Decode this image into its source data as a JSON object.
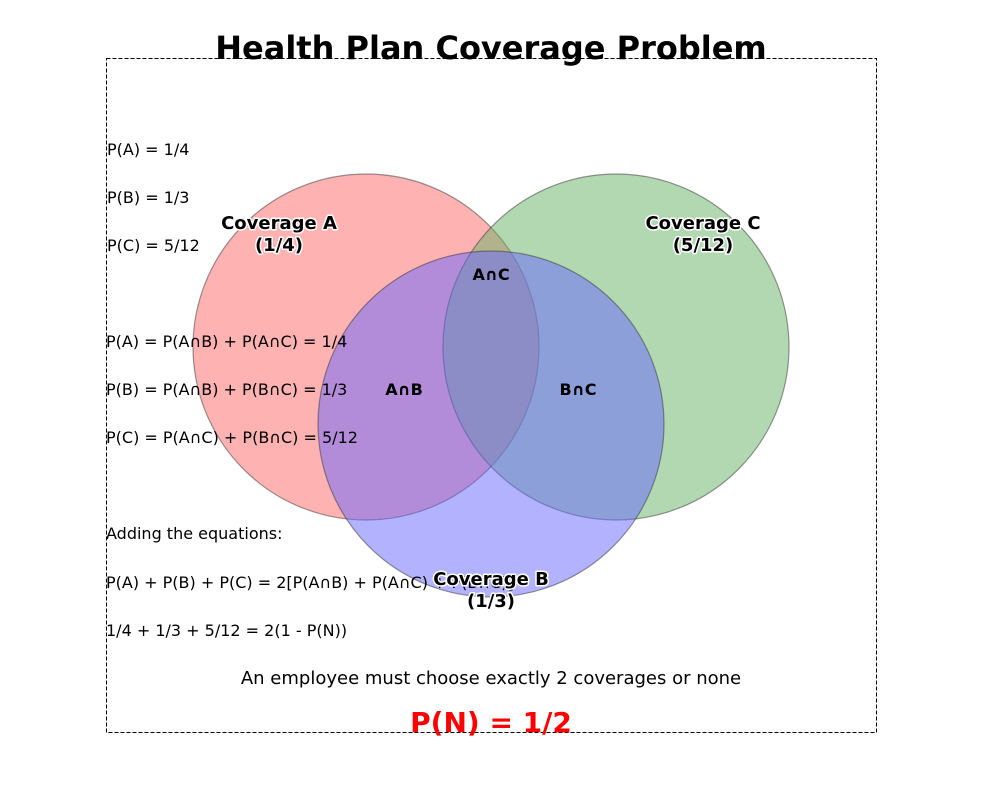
{
  "title": "Health Plan Coverage Problem",
  "circles": {
    "a": {
      "label": "Coverage A",
      "value": "(1/4)",
      "color": "#ff6666"
    },
    "b": {
      "label": "Coverage B",
      "value": "(1/3)",
      "color": "#6666ff"
    },
    "c": {
      "label": "Coverage C",
      "value": "(5/12)",
      "color": "#66b266"
    }
  },
  "regions": {
    "ab": "A∩B",
    "ac": "A∩C",
    "bc": "B∩C"
  },
  "probabilities": {
    "pa": "P(A) = 1/4",
    "pb": "P(B) = 1/3",
    "pc": "P(C) = 5/12"
  },
  "equations": {
    "eq1": "P(A) = P(A∩B) + P(A∩C) = 1/4",
    "eq2": "P(B) = P(A∩B) + P(B∩C) = 1/3",
    "eq3": "P(C) = P(A∩C) + P(B∩C) = 5/12"
  },
  "adding": {
    "heading": "Adding the equations:",
    "line1": "P(A) + P(B) + P(C) = 2[P(A∩B) + P(A∩C) + P(B∩C)]",
    "line2": "1/4 + 1/3 + 5/12 = 2(1 - P(N))"
  },
  "note": "An employee must choose exactly 2 coverages or none",
  "answer": {
    "text": "P(N) = 1/2",
    "color": "#ff0000"
  }
}
